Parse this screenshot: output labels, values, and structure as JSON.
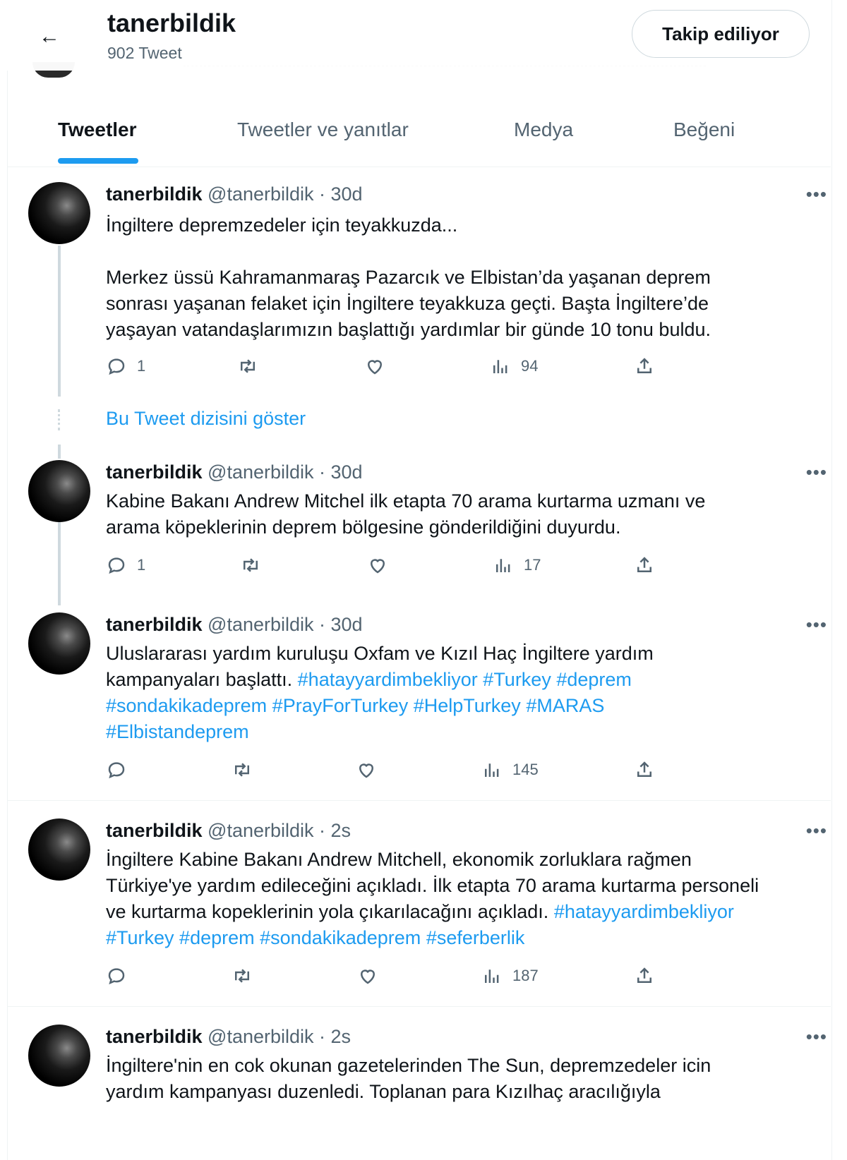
{
  "header": {
    "name": "tanerbildik",
    "tweet_count": "902 Tweet",
    "follow_label": "Takip ediliyor"
  },
  "tabs": [
    {
      "label": "Tweetler",
      "active": true
    },
    {
      "label": "Tweetler ve yanıtlar",
      "active": false
    },
    {
      "label": "Medya",
      "active": false
    },
    {
      "label": "Beğeni",
      "active": false
    }
  ],
  "show_thread_label": "Bu Tweet dizisini göster",
  "tweets": [
    {
      "name": "tanerbildik",
      "meta": "@tanerbildik · 30d",
      "body": [
        "İngiltere depremzedeler için teyakkuzda...",
        "",
        "Merkez üssü Kahramanmaraş Pazarcık ve Elbistan’da yaşanan deprem sonrası yaşanan felaket için İngiltere teyakkuza geçti. Başta İngiltere’de yaşayan vatandaşlarımızın başlattığı yardımlar bir günde 10 tonu buldu."
      ],
      "replies": "1",
      "views": "94"
    },
    {
      "name": "tanerbildik",
      "meta": "@tanerbildik · 30d",
      "body": "Kabine Bakanı Andrew Mitchel ilk etapta 70 arama kurtarma uzmanı ve arama köpeklerinin deprem bölgesine gönderildiğini duyurdu.",
      "replies": "1",
      "views": "17"
    },
    {
      "name": "tanerbildik",
      "meta": "@tanerbildik · 30d",
      "text": "Uluslararası yardım kuruluşu Oxfam ve Kızıl Haç İngiltere yardım kampanyaları başlattı.",
      "hashtags": [
        "#hatayyardimbekliyor",
        "#Turkey",
        "#deprem",
        "#sondakikadeprem",
        "#PrayForTurkey",
        "#HelpTurkey",
        "#MARAS",
        "#Elbistandeprem"
      ],
      "replies": "",
      "views": "145"
    },
    {
      "name": "tanerbildik",
      "meta": "@tanerbildik · 2s",
      "text": "İngiltere Kabine Bakanı Andrew Mitchell, ekonomik zorluklara rağmen Türkiye'ye yardım edileceğini açıkladı. İlk etapta 70 arama kurtarma personeli ve kurtarma kopeklerinin yola çıkarılacağını açıkladı.",
      "hashtags": [
        "#hatayyardimbekliyor",
        "#Turkey",
        "#deprem",
        "#sondakikadeprem",
        "#seferberlik"
      ],
      "replies": "",
      "views": "187"
    },
    {
      "name": "tanerbildik",
      "meta": "@tanerbildik · 2s",
      "text": "İngiltere'nin en cok okunan gazetelerinden The Sun, depremzedeler icin yardım kampanyası duzenledi. Toplanan para Kızılhaç aracılığıyla"
    }
  ],
  "icons": {
    "back": "arrow-left-icon",
    "reply": "reply-icon",
    "retweet": "retweet-icon",
    "like": "heart-icon",
    "views": "views-icon",
    "share": "share-icon",
    "more": "more-icon"
  },
  "colors": {
    "accent": "#1d9bf0",
    "muted": "#536471",
    "text": "#0f1419"
  }
}
